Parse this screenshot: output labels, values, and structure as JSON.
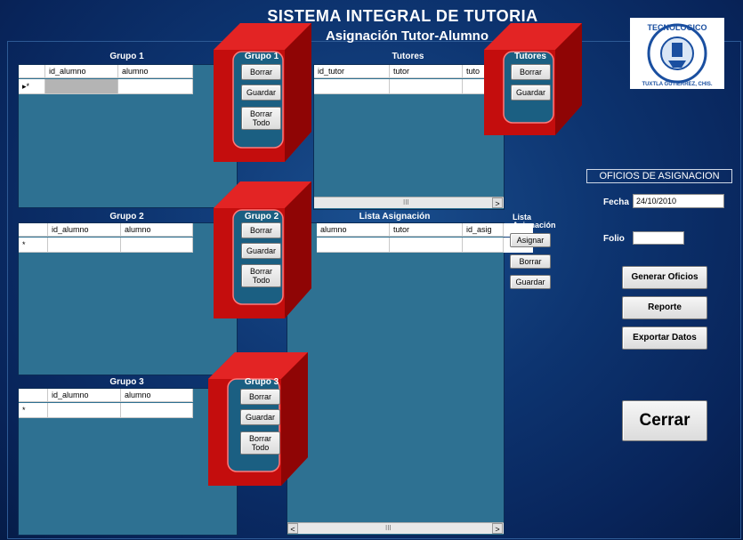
{
  "header": {
    "title": "SISTEMA INTEGRAL DE TUTORIA",
    "subtitle": "Asignación Tutor-Alumno"
  },
  "grupo1": {
    "caption": "Grupo 1",
    "columns": [
      "id_alumno",
      "alumno"
    ],
    "row_marker": "▸*",
    "buttons_caption": "Grupo 1",
    "borrar": "Borrar",
    "guardar": "Guardar",
    "borrar_todo_1": "Borrar",
    "borrar_todo_2": "Todo"
  },
  "grupo2": {
    "caption": "Grupo 2",
    "columns": [
      "id_alumno",
      "alumno"
    ],
    "row_marker": "*",
    "buttons_caption": "Grupo 2",
    "borrar": "Borrar",
    "guardar": "Guardar",
    "borrar_todo_1": "Borrar",
    "borrar_todo_2": "Todo"
  },
  "grupo3": {
    "caption": "Grupo 3",
    "columns": [
      "id_alumno",
      "alumno"
    ],
    "row_marker": "*",
    "buttons_caption": "Grupo 3",
    "borrar": "Borrar",
    "guardar": "Guardar",
    "borrar_todo_1": "Borrar",
    "borrar_todo_2": "Todo"
  },
  "tutores": {
    "caption": "Tutores",
    "columns": [
      "id_tutor",
      "tutor",
      "tuto"
    ],
    "buttons_caption": "Tutores",
    "borrar": "Borrar",
    "guardar": "Guardar",
    "scroll_mid": "III",
    "scroll_right": ">"
  },
  "lista": {
    "caption": "Lista Asignación",
    "columns": [
      "alumno",
      "tutor",
      "id_asig"
    ],
    "buttons_caption_1": "Lista",
    "buttons_caption_2": "Asignación",
    "asignar": "Asignar",
    "borrar": "Borrar",
    "guardar": "Guardar",
    "scroll_left": "<",
    "scroll_mid": "III",
    "scroll_right": ">"
  },
  "oficios": {
    "title": "OFICIOS DE ASIGNACION",
    "fecha_label": "Fecha",
    "fecha_value": "24/10/2010",
    "folio_label": "Folio",
    "folio_value": "",
    "generar": "Generar Oficios",
    "reporte": "Reporte",
    "exportar": "Exportar Datos",
    "cerrar": "Cerrar"
  },
  "logo": {
    "text_top": "TECNOLOGICO",
    "text_bottom": "TUXTLA GUTIERREZ, CHIS."
  },
  "colors": {
    "background": "#0d3470",
    "panel": "#2e7192",
    "highlight": "#d01010"
  }
}
